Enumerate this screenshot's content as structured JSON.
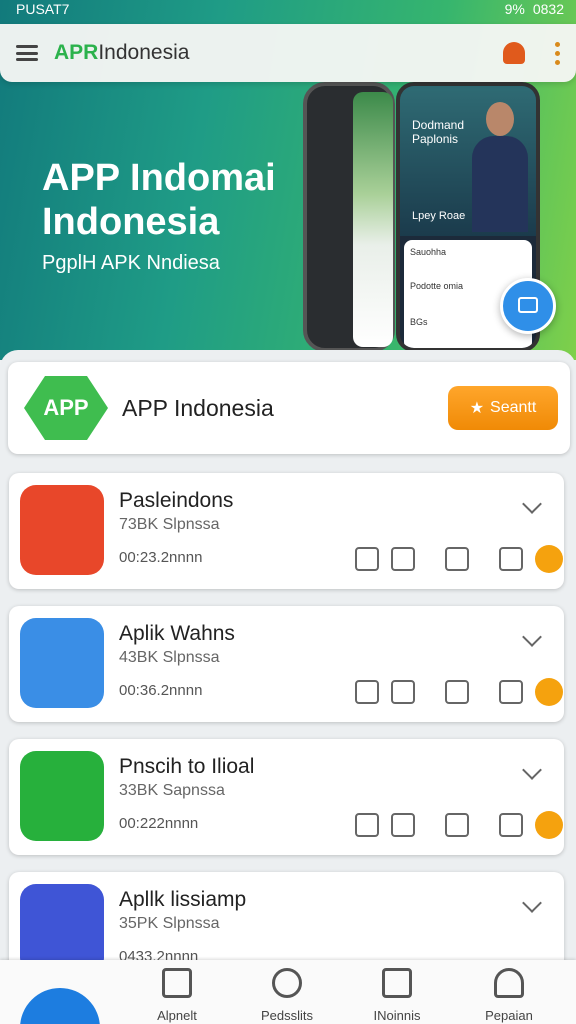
{
  "status_bar": {
    "left": "PUSAT7",
    "right": "9%",
    "time": "0832"
  },
  "app_bar": {
    "logo_accent": "APR",
    "logo_rest": "Indonesia"
  },
  "hero": {
    "title": "APP Indomai Indonesia",
    "subtitle": "PgplH APK Nndiesa",
    "phone_text": "Dodmand Paplonis",
    "phone_caption": "Lpey Roae",
    "card_lines": [
      "Sauohha",
      "Podotte omia",
      "BGs"
    ]
  },
  "featured": {
    "badge": "APP",
    "name": "APP Indonesia",
    "button_label": "Seantt"
  },
  "apps": [
    {
      "title": "Pasleindons",
      "subtitle": "73BK Slpnssa",
      "duration": "00:23.2nnnn",
      "color": "#e8472a"
    },
    {
      "title": "Aplik Wahns",
      "subtitle": "43BK Slpnssa",
      "duration": "00:36.2nnnn",
      "color": "#3a8ee6"
    },
    {
      "title": "Pnscih to Ilioal",
      "subtitle": "33BK Sapnssa",
      "duration": "00:222nnnn",
      "color": "#27b03c"
    },
    {
      "title": "Apllk lissiamp",
      "subtitle": "35PK Slpnssa",
      "duration": "0433.2nnnn",
      "color": "#3f55d6"
    }
  ],
  "action_icons": [
    "pages-icon",
    "text-icon",
    "notes-icon",
    "user-icon",
    "badge-icon"
  ],
  "bottom_nav": [
    {
      "label": "Alpnelt",
      "icon": "menu-icon"
    },
    {
      "label": "Pedsslits",
      "icon": "search-icon"
    },
    {
      "label": "INoinnis",
      "icon": "portrait-icon"
    },
    {
      "label": "Pepaian",
      "icon": "profile-icon"
    }
  ]
}
